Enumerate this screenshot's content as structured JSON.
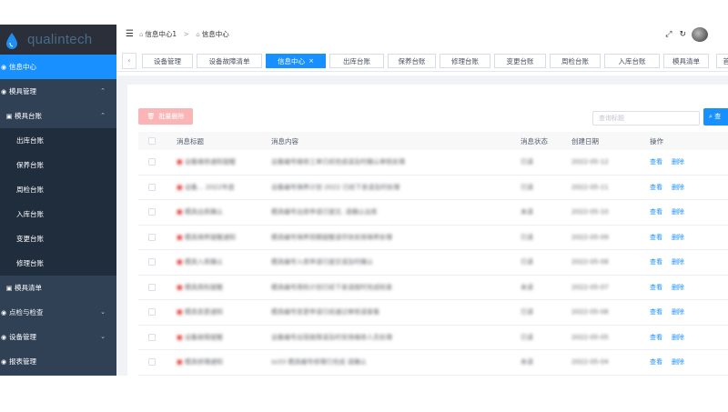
{
  "sidebar": {
    "logo_text": "qualintech",
    "items": [
      {
        "label": "信息中心",
        "level": 1,
        "active": true,
        "chevron": ""
      },
      {
        "label": "模具管理",
        "level": 1,
        "active": false,
        "chevron": "^"
      },
      {
        "label": "模具台账",
        "level": 2,
        "active": false,
        "chevron": "^"
      },
      {
        "label": "出库台账",
        "level": 3,
        "active": false,
        "chevron": ""
      },
      {
        "label": "保养台账",
        "level": 3,
        "active": false,
        "chevron": ""
      },
      {
        "label": "周检台账",
        "level": 3,
        "active": false,
        "chevron": ""
      },
      {
        "label": "入库台账",
        "level": 3,
        "active": false,
        "chevron": ""
      },
      {
        "label": "变更台账",
        "level": 3,
        "active": false,
        "chevron": ""
      },
      {
        "label": "修理台账",
        "level": 3,
        "active": false,
        "chevron": ""
      },
      {
        "label": "模具清单",
        "level": 2,
        "active": false,
        "chevron": ""
      },
      {
        "label": "点检与检查",
        "level": 1,
        "active": false,
        "chevron": "v"
      },
      {
        "label": "设备管理",
        "level": 1,
        "active": false,
        "chevron": "v"
      },
      {
        "label": "报表管理",
        "level": 1,
        "active": false,
        "chevron": ""
      }
    ]
  },
  "navbar": {
    "breadcrumb": [
      "信息中心1",
      "信息中心"
    ]
  },
  "tags": [
    {
      "label": "设备管理",
      "active": false
    },
    {
      "label": "设备故障清单",
      "active": false
    },
    {
      "label": "信息中心",
      "active": true
    },
    {
      "label": "出库台账",
      "active": false
    },
    {
      "label": "保养台账",
      "active": false
    },
    {
      "label": "修理台账",
      "active": false
    },
    {
      "label": "变更台账",
      "active": false
    },
    {
      "label": "周检台账",
      "active": false
    },
    {
      "label": "入库台账",
      "active": false
    },
    {
      "label": "模具清单",
      "active": false
    },
    {
      "label": "首页",
      "active": false
    }
  ],
  "toolbar": {
    "batch_delete": "批量删除",
    "search_placeholder": "查询标题",
    "search_button": "查"
  },
  "table": {
    "headers": [
      "消息标题",
      "消息内容",
      "消息状态",
      "创建日期",
      "操作"
    ],
    "row_actions": {
      "view": "查看",
      "delete": "删除"
    },
    "rows": [
      {
        "title": "■ 设备维修通知提醒",
        "content": "设备编号维修工单已经完成请及时确认审核处理",
        "status": "已读",
        "date": "2022-05-12"
      },
      {
        "title": "■ 设备... 2022年度",
        "content": "设备编号保养计划 2022 已经下发请及时处理",
        "status": "已读",
        "date": "2022-05-11"
      },
      {
        "title": "■ 模具出库确认",
        "content": "模具编号出库申请已提交, 请确认出库",
        "status": "未读",
        "date": "2022-05-10"
      },
      {
        "title": "■ 模具保养提醒通知",
        "content": "模具编号保养到期提醒请尽快安排保养处理",
        "status": "已读",
        "date": "2022-05-09"
      },
      {
        "title": "■ 模具入库确认",
        "content": "模具编号入库申请已提交请及时确认",
        "status": "已读",
        "date": "2022-05-08"
      },
      {
        "title": "■ 模具周检提醒",
        "content": "模具编号周检计划已经下发请按时完成检查",
        "status": "未读",
        "date": "2022-05-07"
      },
      {
        "title": "■ 模具变更通知",
        "content": "模具编号变更申请已经通过审核请查看",
        "status": "已读",
        "date": "2022-05-06"
      },
      {
        "title": "■ 设备故障提醒",
        "content": "设备编号出现故障请及时安排维修人员处理",
        "status": "已读",
        "date": "2022-05-05"
      },
      {
        "title": "■ 模具修理通知",
        "content": "ss33 模具编号修理已完成 请确认",
        "status": "未读",
        "date": "2022-05-04"
      }
    ]
  }
}
